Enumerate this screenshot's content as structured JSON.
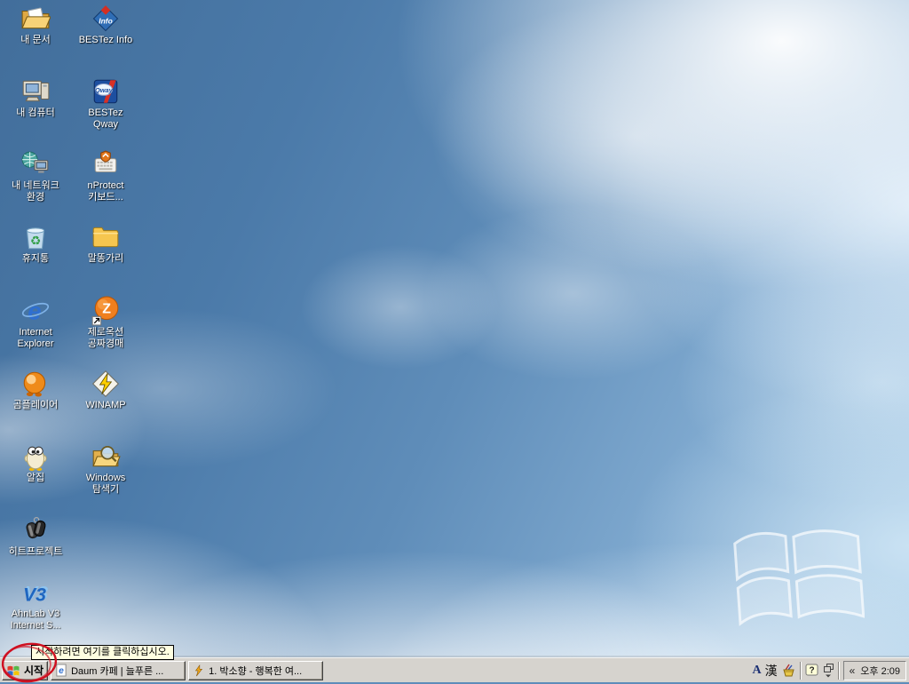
{
  "desktop": {
    "icons": [
      {
        "label": "내 문서",
        "icon": "my-documents-icon"
      },
      {
        "label": "BESTez Info",
        "icon": "bestez-info-icon"
      },
      {
        "label": "내 컴퓨터",
        "icon": "my-computer-icon"
      },
      {
        "label": "BESTez\nQway",
        "icon": "bestez-qway-icon"
      },
      {
        "label": "내 네트워크\n환경",
        "icon": "my-network-icon"
      },
      {
        "label": "nProtect\n키보드...",
        "icon": "nprotect-keyboard-icon"
      },
      {
        "label": "휴지통",
        "icon": "recycle-bin-icon"
      },
      {
        "label": "말똥가리",
        "icon": "folder-icon"
      },
      {
        "label": "Internet\nExplorer",
        "icon": "internet-explorer-icon"
      },
      {
        "label": "제로옥션\n공짜경매",
        "icon": "zero-auction-icon"
      },
      {
        "label": "곰플레이어",
        "icon": "gom-player-icon"
      },
      {
        "label": "WINAMP",
        "icon": "winamp-icon"
      },
      {
        "label": "알집",
        "icon": "alzip-icon"
      },
      {
        "label": "Windows\n탐색기",
        "icon": "windows-explorer-icon"
      },
      {
        "label": "히트프로젝트",
        "icon": "hit-project-icon"
      },
      {
        "label": "AhnLab V3\nInternet S...",
        "icon": "ahnlab-v3-icon"
      }
    ],
    "watermark": "windows-flag-watermark"
  },
  "tooltip": {
    "text": "시작하려면 여기를 클릭하십시오."
  },
  "taskbar": {
    "start_label": "시작",
    "buttons": [
      {
        "label": "Daum 카페 | 늘푸른 ...",
        "icon": "internet-explorer-small-icon"
      },
      {
        "label": "1. 박소향 - 행복한 여...",
        "icon": "winamp-small-icon"
      }
    ],
    "tray": {
      "ime_english": "A",
      "ime_hanja": "漢",
      "collapse_chevron": "«",
      "clock": "오후 2:09"
    }
  },
  "annotation": {
    "shape": "hand-drawn red ellipse around start button",
    "color": "#cf1020"
  },
  "colors": {
    "sky_top": "#426e9b",
    "sky_bottom": "#a5c9e5",
    "taskbar_bg": "#d6d3ce",
    "tooltip_bg": "#ffffe1",
    "annotation_red": "#cf1020",
    "label_text": "#ffffff"
  }
}
